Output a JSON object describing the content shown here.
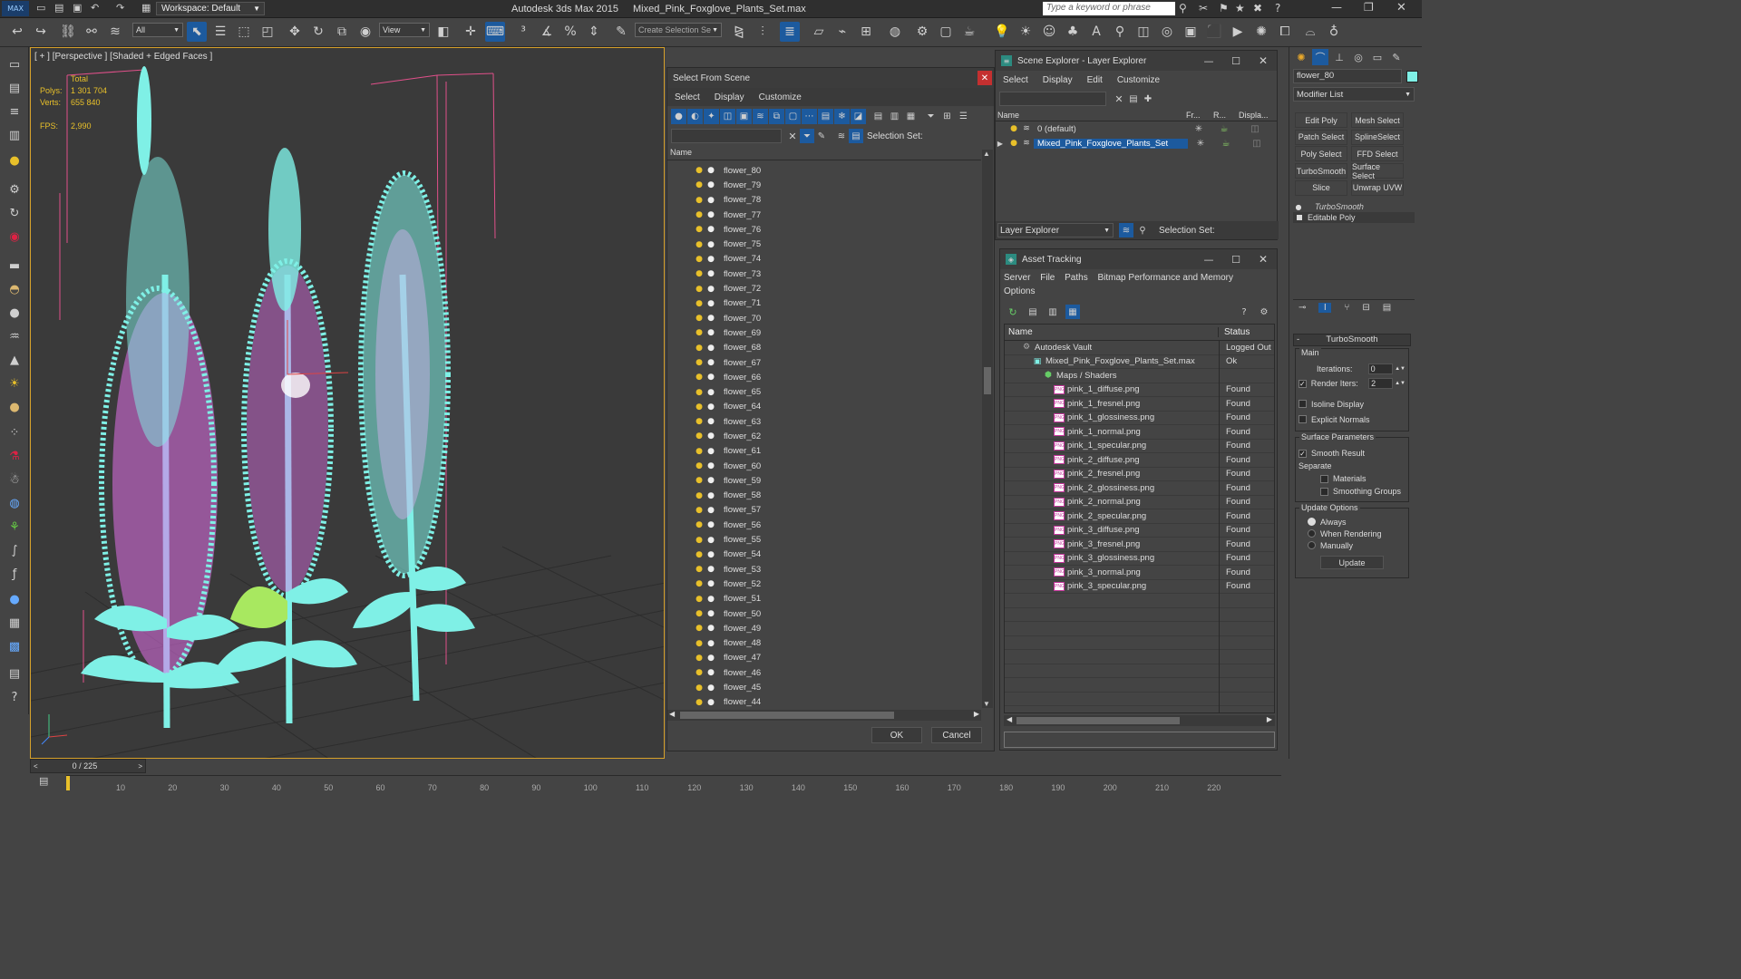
{
  "app": {
    "title": "Autodesk 3ds Max  2015",
    "file": "Mixed_Pink_Foxglove_Plants_Set.max",
    "workspace": "Workspace: Default",
    "search_placeholder": "Type a keyword or phrase",
    "max_label": "MAX"
  },
  "toolbar": {
    "filter_value": "All",
    "refcoord_value": "View",
    "selection_set_placeholder": "Create Selection Se"
  },
  "viewport": {
    "label": "[ + ] [Perspective ] [Shaded + Edged Faces ]",
    "stats": {
      "total_label": "Total",
      "polys_label": "Polys:",
      "polys_value": "1 301 704",
      "verts_label": "Verts:",
      "verts_value": "655 840",
      "fps_label": "FPS:",
      "fps_value": "2,990"
    }
  },
  "select_from_scene": {
    "title": "Select From Scene",
    "menu": [
      "Select",
      "Display",
      "Customize"
    ],
    "selection_set_label": "Selection Set:",
    "column_name": "Name",
    "items": [
      "flower_80",
      "flower_79",
      "flower_78",
      "flower_77",
      "flower_76",
      "flower_75",
      "flower_74",
      "flower_73",
      "flower_72",
      "flower_71",
      "flower_70",
      "flower_69",
      "flower_68",
      "flower_67",
      "flower_66",
      "flower_65",
      "flower_64",
      "flower_63",
      "flower_62",
      "flower_61",
      "flower_60",
      "flower_59",
      "flower_58",
      "flower_57",
      "flower_56",
      "flower_55",
      "flower_54",
      "flower_53",
      "flower_52",
      "flower_51",
      "flower_50",
      "flower_49",
      "flower_48",
      "flower_47",
      "flower_46",
      "flower_45",
      "flower_44"
    ],
    "ok_label": "OK",
    "cancel_label": "Cancel"
  },
  "scene_explorer": {
    "title": "Scene Explorer - Layer Explorer",
    "menu": [
      "Select",
      "Display",
      "Edit",
      "Customize"
    ],
    "columns": [
      "Name",
      "Fr...",
      "R...",
      "Displa..."
    ],
    "layers": [
      "0 (default)",
      "Mixed_Pink_Foxglove_Plants_Set"
    ],
    "footer_dropdown": "Layer Explorer",
    "selection_set_label": "Selection Set:"
  },
  "asset_tracking": {
    "title": "Asset Tracking",
    "menu": [
      "Server",
      "File",
      "Paths",
      "Bitmap Performance and Memory",
      "Options"
    ],
    "columns": [
      "Name",
      "Status"
    ],
    "rows": [
      {
        "name": "Autodesk Vault",
        "status": "Logged Out",
        "indent": 1,
        "kind": "vault"
      },
      {
        "name": "Mixed_Pink_Foxglove_Plants_Set.max",
        "status": "Ok",
        "indent": 2,
        "kind": "file"
      },
      {
        "name": "Maps / Shaders",
        "status": "",
        "indent": 3,
        "kind": "folder"
      },
      {
        "name": "pink_1_diffuse.png",
        "status": "Found",
        "indent": 4,
        "kind": "png"
      },
      {
        "name": "pink_1_fresnel.png",
        "status": "Found",
        "indent": 4,
        "kind": "png"
      },
      {
        "name": "pink_1_glossiness.png",
        "status": "Found",
        "indent": 4,
        "kind": "png"
      },
      {
        "name": "pink_1_normal.png",
        "status": "Found",
        "indent": 4,
        "kind": "png"
      },
      {
        "name": "pink_1_specular.png",
        "status": "Found",
        "indent": 4,
        "kind": "png"
      },
      {
        "name": "pink_2_diffuse.png",
        "status": "Found",
        "indent": 4,
        "kind": "png"
      },
      {
        "name": "pink_2_fresnel.png",
        "status": "Found",
        "indent": 4,
        "kind": "png"
      },
      {
        "name": "pink_2_glossiness.png",
        "status": "Found",
        "indent": 4,
        "kind": "png"
      },
      {
        "name": "pink_2_normal.png",
        "status": "Found",
        "indent": 4,
        "kind": "png"
      },
      {
        "name": "pink_2_specular.png",
        "status": "Found",
        "indent": 4,
        "kind": "png"
      },
      {
        "name": "pink_3_diffuse.png",
        "status": "Found",
        "indent": 4,
        "kind": "png"
      },
      {
        "name": "pink_3_fresnel.png",
        "status": "Found",
        "indent": 4,
        "kind": "png"
      },
      {
        "name": "pink_3_glossiness.png",
        "status": "Found",
        "indent": 4,
        "kind": "png"
      },
      {
        "name": "pink_3_normal.png",
        "status": "Found",
        "indent": 4,
        "kind": "png"
      },
      {
        "name": "pink_3_specular.png",
        "status": "Found",
        "indent": 4,
        "kind": "png"
      }
    ],
    "png_badge": "PNG"
  },
  "command_panel": {
    "object_name": "flower_80",
    "modifier_list": "Modifier List",
    "buttons": [
      "Edit Poly",
      "Mesh Select",
      "Patch Select",
      "SplineSelect",
      "Poly Select",
      "FFD Select",
      "TurboSmooth",
      "Surface Select",
      "Slice",
      "Unwrap UVW"
    ],
    "stack": [
      "TurboSmooth",
      "Editable Poly"
    ],
    "rollout_title": "TurboSmooth",
    "main_label": "Main",
    "iterations_label": "Iterations:",
    "iterations_value": "0",
    "render_iters_label": "Render Iters:",
    "render_iters_value": "2",
    "isoline_label": "Isoline Display",
    "explicit_normals_label": "Explicit Normals",
    "surface_params_label": "Surface Parameters",
    "smooth_result_label": "Smooth Result",
    "separate_label": "Separate",
    "materials_label": "Materials",
    "smoothing_groups_label": "Smoothing Groups",
    "update_options_label": "Update Options",
    "always_label": "Always",
    "when_rendering_label": "When Rendering",
    "manually_label": "Manually",
    "update_button": "Update"
  },
  "timeline": {
    "frame_counter": "0 / 225",
    "ticks": [
      "10",
      "20",
      "30",
      "40",
      "50",
      "60",
      "70",
      "80",
      "90",
      "100",
      "110",
      "120",
      "130",
      "140",
      "150",
      "160",
      "170",
      "180",
      "190",
      "200",
      "210",
      "220"
    ]
  },
  "colors": {
    "accent_blue": "#1c5a9e",
    "viewport_border": "#d6a12b",
    "stats_yellow": "#e8c02a",
    "wire_cyan": "#7ff0e6",
    "wire_pink": "#e070e8",
    "bbox_pink": "#e0508a"
  }
}
